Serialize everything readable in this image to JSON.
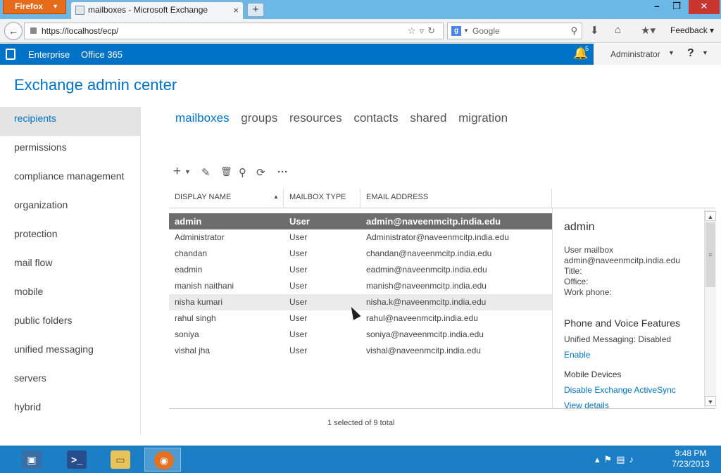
{
  "browser": {
    "app_button": "Firefox",
    "tab_title": "mailboxes - Microsoft Exchange",
    "tab_close": "×",
    "new_tab": "+",
    "url": "https://localhost/ecp/",
    "search_placeholder": "Google",
    "feedback_label": "Feedback",
    "window_buttons": {
      "minimize": "–",
      "maximize": "❐",
      "close": "✕"
    }
  },
  "eac_header": {
    "enterprise_label": "Enterprise",
    "office365_label": "Office 365",
    "notification_count": "5",
    "user_name": "Administrator",
    "help_label": "?"
  },
  "page": {
    "title": "Exchange admin center"
  },
  "sidebar": {
    "items": [
      {
        "label": "recipients",
        "active": true
      },
      {
        "label": "permissions"
      },
      {
        "label": "compliance management"
      },
      {
        "label": "organization"
      },
      {
        "label": "protection"
      },
      {
        "label": "mail flow"
      },
      {
        "label": "mobile"
      },
      {
        "label": "public folders"
      },
      {
        "label": "unified messaging"
      },
      {
        "label": "servers"
      },
      {
        "label": "hybrid"
      }
    ]
  },
  "subtabs": [
    {
      "label": "mailboxes",
      "active": true
    },
    {
      "label": "groups"
    },
    {
      "label": "resources"
    },
    {
      "label": "contacts"
    },
    {
      "label": "shared"
    },
    {
      "label": "migration"
    }
  ],
  "toolbar": {
    "add": "+",
    "edit": "✎",
    "delete": "🗑",
    "search": "⚲",
    "refresh": "⟳",
    "more": "···"
  },
  "grid": {
    "columns": [
      "DISPLAY NAME",
      "MAILBOX TYPE",
      "EMAIL ADDRESS"
    ],
    "rows": [
      {
        "name": "admin",
        "type": "User",
        "email": "admin@naveenmcitp.india.edu",
        "selected": true
      },
      {
        "name": "Administrator",
        "type": "User",
        "email": "Administrator@naveenmcitp.india.edu"
      },
      {
        "name": "chandan",
        "type": "User",
        "email": "chandan@naveenmcitp.india.edu"
      },
      {
        "name": "eadmin",
        "type": "User",
        "email": "eadmin@naveenmcitp.india.edu"
      },
      {
        "name": "manish naithani",
        "type": "User",
        "email": "manish@naveenmcitp.india.edu"
      },
      {
        "name": "nisha kumari",
        "type": "User",
        "email": "nisha.k@naveenmcitp.india.edu",
        "hover": true
      },
      {
        "name": "rahul singh",
        "type": "User",
        "email": "rahul@naveenmcitp.india.edu"
      },
      {
        "name": "soniya",
        "type": "User",
        "email": "soniya@naveenmcitp.india.edu"
      },
      {
        "name": "vishal jha",
        "type": "User",
        "email": "vishal@naveenmcitp.india.edu"
      }
    ],
    "status": "1 selected of 9 total"
  },
  "details": {
    "name": "admin",
    "kind": "User mailbox",
    "email": "admin@naveenmcitp.india.edu",
    "title_label": "Title:",
    "office_label": "Office:",
    "work_phone_label": "Work phone:",
    "phone_voice_heading": "Phone and Voice Features",
    "um_status": "Unified Messaging: Disabled",
    "enable_link": "Enable",
    "mobile_heading": "Mobile Devices",
    "disable_eas_link": "Disable Exchange ActiveSync",
    "view_details_link": "View details"
  },
  "taskbar": {
    "time": "9:48 PM",
    "date": "7/23/2013"
  }
}
